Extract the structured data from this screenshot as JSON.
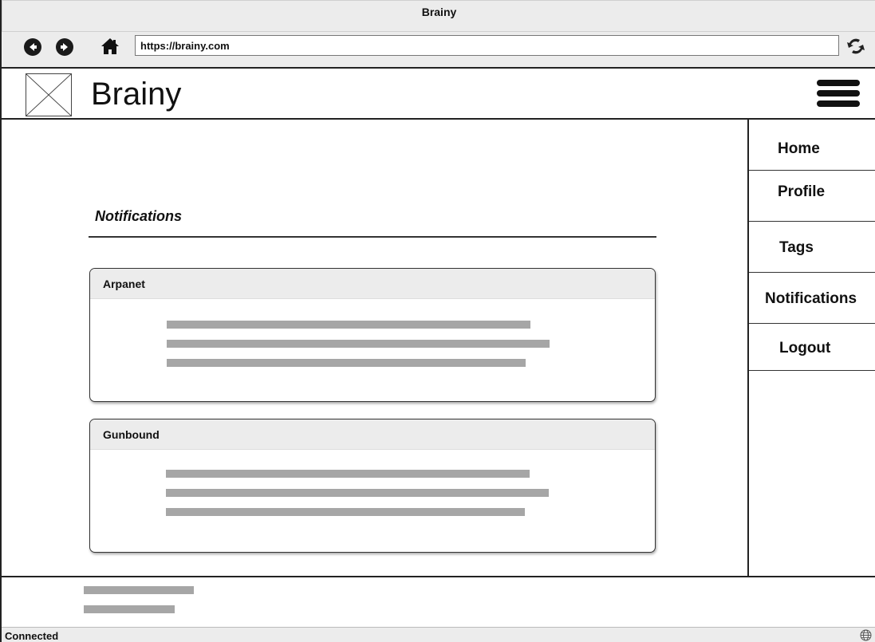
{
  "window": {
    "title": "Brainy"
  },
  "toolbar": {
    "url": "https://brainy.com"
  },
  "header": {
    "app_title": "Brainy"
  },
  "sidebar": {
    "items": [
      {
        "label": "Home"
      },
      {
        "label": "Profile"
      },
      {
        "label": "Tags"
      },
      {
        "label": "Notifications"
      },
      {
        "label": "Logout"
      }
    ]
  },
  "main": {
    "section_title": "Notifications",
    "cards": [
      {
        "title": "Arpanet"
      },
      {
        "title": "Gunbound"
      }
    ]
  },
  "status": {
    "text": "Connected"
  },
  "icons": [
    "back-arrow-icon",
    "forward-arrow-icon",
    "home-icon",
    "refresh-icon",
    "image-placeholder-icon",
    "hamburger-menu-icon",
    "globe-icon"
  ]
}
